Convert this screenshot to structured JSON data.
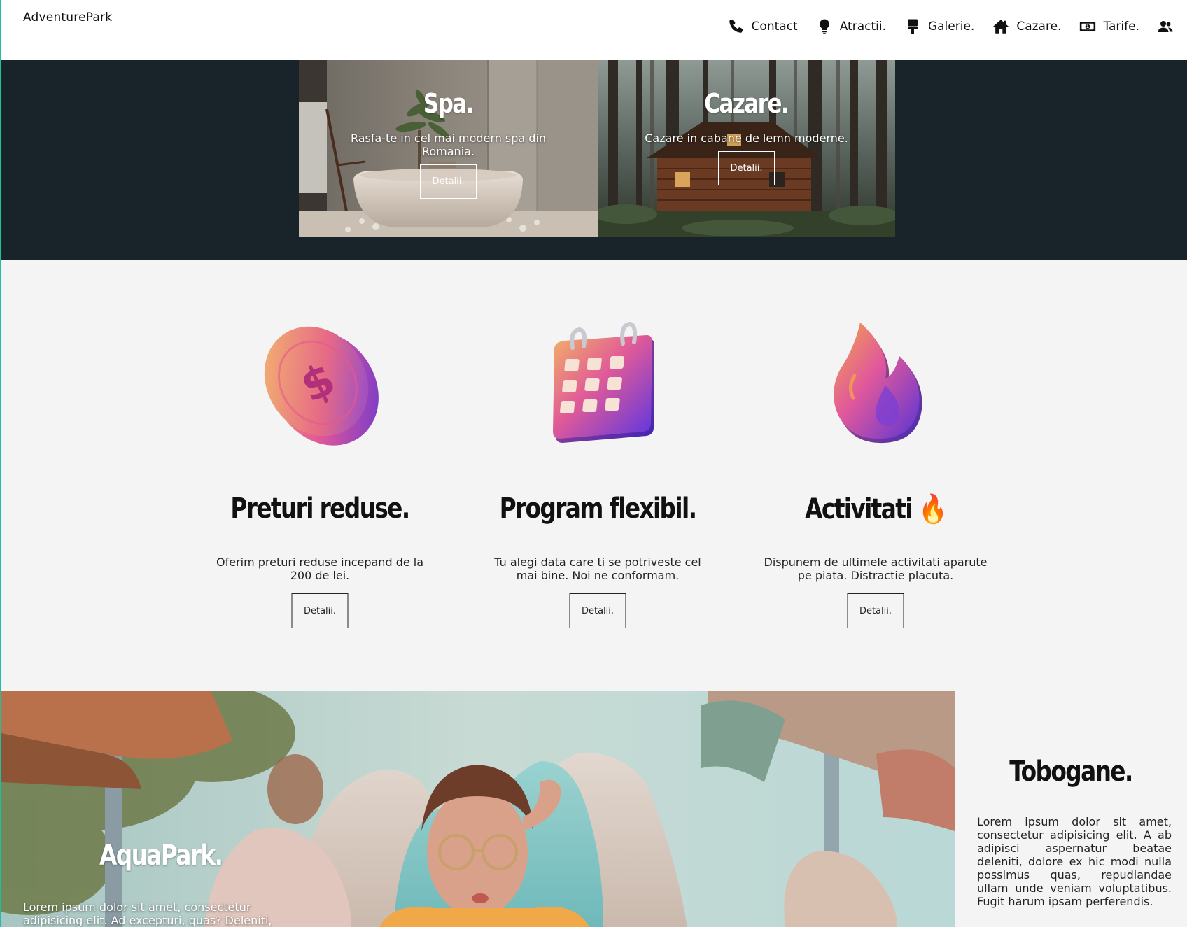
{
  "brand": "AdventurePark",
  "nav": {
    "items": [
      {
        "label": "Contact",
        "icon": "phone-icon"
      },
      {
        "label": "Atractii.",
        "icon": "lightbulb-icon"
      },
      {
        "label": "Galerie.",
        "icon": "paintbrush-icon"
      },
      {
        "label": "Cazare.",
        "icon": "house-icon"
      },
      {
        "label": "Tarife.",
        "icon": "money-icon"
      }
    ],
    "user_icon": "users-icon"
  },
  "hero": {
    "cards": [
      {
        "title": "Spa.",
        "desc": "Rasfa-te in cel mai modern spa din Romania.",
        "button": "Detalii."
      },
      {
        "title": "Cazare.",
        "desc": "Cazare in cabane de lemn moderne.",
        "button": "Detalii."
      }
    ]
  },
  "features": [
    {
      "title": "Preturi reduse.",
      "desc": "Oferim preturi reduse incepand de la 200 de lei.",
      "button": "Detalii.",
      "icon": "coin-icon"
    },
    {
      "title": "Program flexibil.",
      "desc": "Tu alegi data care ti se potriveste cel mai bine. Noi ne conformam.",
      "button": "Detalii.",
      "icon": "calendar-icon"
    },
    {
      "title": "Activitati 🔥",
      "desc": "Dispunem de ultimele activitati aparute pe piata. Distractie placuta.",
      "button": "Detalii.",
      "icon": "flame-icon"
    }
  ],
  "aquapark": {
    "title": "AquaPark.",
    "desc": "Lorem ipsum dolor sit amet, consectetur adipisicing elit. Ad excepturi, quas? Deleniti,"
  },
  "tobogane": {
    "title": "Tobogane.",
    "desc": "Lorem ipsum dolor sit amet, consectetur adipisicing elit. A ab adipisci aspernatur beatae deleniti, dolore ex hic modi nulla possimus quas, repudiandae ullam unde veniam voluptatibus. Fugit harum ipsam perferendis."
  },
  "colors": {
    "accent": "#1fbf9f",
    "hero_bg": "#19232a",
    "section_bg": "#f4f4f4"
  }
}
